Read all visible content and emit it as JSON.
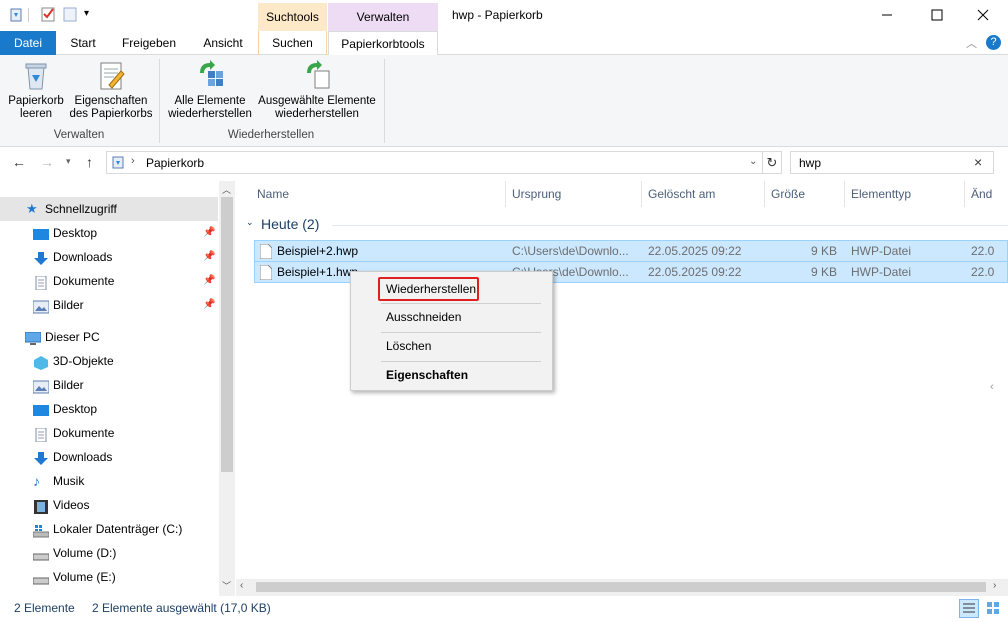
{
  "titlebar": {
    "context_tab_suchtools": "Suchtools",
    "context_tab_verwalten": "Verwalten",
    "window_title": "hwp - Papierkorb",
    "accent_suchtools": "#fde8c8",
    "accent_verwalten": "#eedcf5"
  },
  "ribbon_tabs": {
    "datei": "Datei",
    "start": "Start",
    "freigeben": "Freigeben",
    "ansicht": "Ansicht",
    "suchen": "Suchen",
    "papierkorbtools": "Papierkorbtools"
  },
  "ribbon": {
    "empty_bin_l1": "Papierkorb",
    "empty_bin_l2": "leeren",
    "props_l1": "Eigenschaften",
    "props_l2": "des Papierkorbs",
    "group_manage": "Verwalten",
    "restore_all_l1": "Alle Elemente",
    "restore_all_l2": "wiederherstellen",
    "restore_sel_l1": "Ausgewählte Elemente",
    "restore_sel_l2": "wiederherstellen",
    "group_restore": "Wiederherstellen"
  },
  "address": {
    "path": "Papierkorb",
    "search_value": "hwp"
  },
  "navpane": {
    "quick_access": "Schnellzugriff",
    "qa_items": [
      "Desktop",
      "Downloads",
      "Dokumente",
      "Bilder"
    ],
    "this_pc": "Dieser PC",
    "pc_items": [
      "3D-Objekte",
      "Bilder",
      "Desktop",
      "Dokumente",
      "Downloads",
      "Musik",
      "Videos",
      "Lokaler Datenträger (C:)",
      "Volume (D:)",
      "Volume (E:)"
    ]
  },
  "columns": {
    "name": "Name",
    "ursprung": "Ursprung",
    "geloescht": "Gelöscht am",
    "groesse": "Größe",
    "typ": "Elementtyp",
    "aend": "Änd"
  },
  "group_header": "Heute (2)",
  "files": [
    {
      "name": "Beispiel+2.hwp",
      "origin": "C:\\Users\\de\\Downlo...",
      "deleted": "22.05.2025 09:22",
      "size": "9 KB",
      "type": "HWP-Datei",
      "changed": "22.0"
    },
    {
      "name": "Beispiel+1.hwp",
      "origin": "C:\\Users\\de\\Downlo...",
      "deleted": "22.05.2025 09:22",
      "size": "9 KB",
      "type": "HWP-Datei",
      "changed": "22.0"
    }
  ],
  "context_menu": {
    "restore": "Wiederherstellen",
    "cut": "Ausschneiden",
    "delete": "Löschen",
    "properties": "Eigenschaften"
  },
  "status": {
    "count": "2 Elemente",
    "selected": "2 Elemente ausgewählt (17,0 KB)"
  }
}
